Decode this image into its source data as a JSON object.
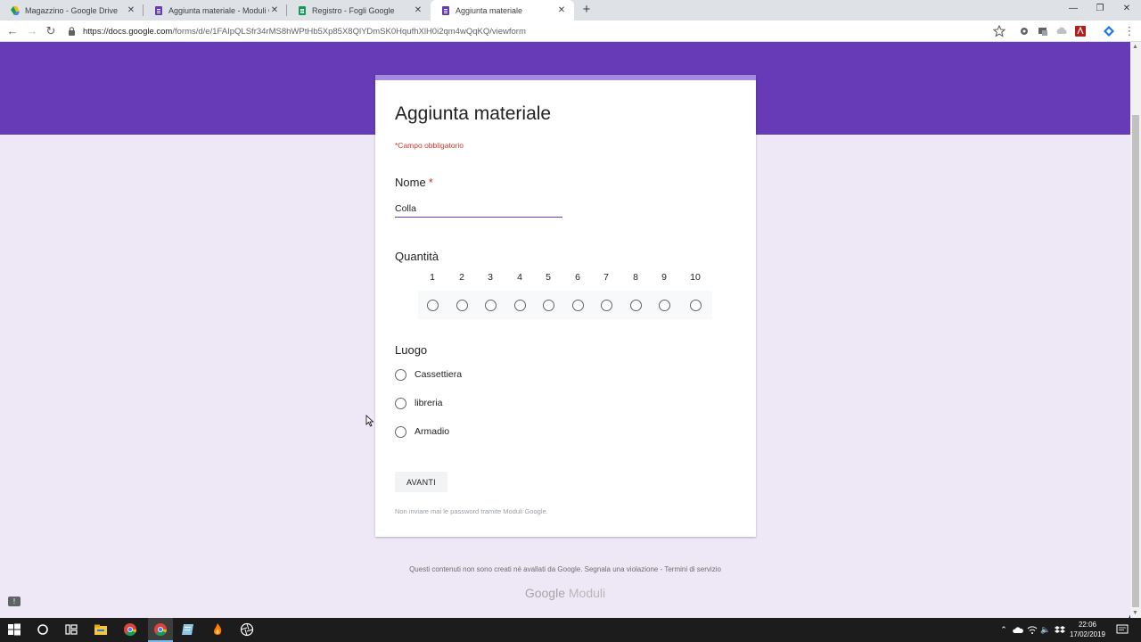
{
  "browser": {
    "tabs": [
      {
        "title": "Magazzino - Google Drive",
        "icon": "google-drive-icon",
        "active": false
      },
      {
        "title": "Aggiunta materiale - Moduli Goo",
        "icon": "google-forms-icon",
        "active": false
      },
      {
        "title": "Registro - Fogli Google",
        "icon": "google-sheets-icon",
        "active": false
      },
      {
        "title": "Aggiunta materiale",
        "icon": "google-forms-icon",
        "active": true
      }
    ],
    "url_host": "https://docs.google.com",
    "url_path": "/forms/d/e/1FAIpQLSfr34rMS8hWPtHb5Xp85X8QlYDmSK0HqufhXlH0i2qm4wQqKQ/viewform"
  },
  "form": {
    "title": "Aggiunta materiale",
    "required_note": "*Campo obbligatorio",
    "questions": {
      "nome": {
        "label": "Nome",
        "required_mark": "*",
        "value": "Colla"
      },
      "quantita": {
        "label": "Quantità",
        "scale": [
          "1",
          "2",
          "3",
          "4",
          "5",
          "6",
          "7",
          "8",
          "9",
          "10"
        ]
      },
      "luogo": {
        "label": "Luogo",
        "options": [
          "Cassettiera",
          "libreria",
          "Armadio"
        ]
      }
    },
    "next_button": "AVANTI",
    "password_note": "Non inviare mai le password tramite Moduli Google."
  },
  "footer": {
    "disclaimer": "Questi contenuti non sono creati né avallati da Google. Segnala una violazione - Termini di servizio",
    "brand_google": "Google",
    "brand_product": "Moduli"
  },
  "taskbar": {
    "time": "22:06",
    "date": "17/02/2019"
  },
  "colors": {
    "accent": "#673ab7",
    "background": "#ede7f6",
    "required": "#d93025"
  }
}
